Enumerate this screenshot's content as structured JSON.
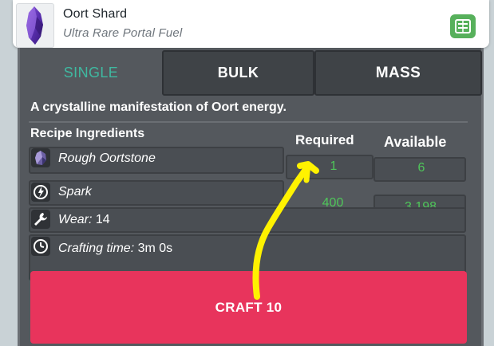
{
  "item": {
    "name": "Oort Shard",
    "subtitle": "Ultra Rare Portal Fuel",
    "thumbnail_icon": "crystal-shard-icon",
    "recipe_icon": "recipe-book-icon"
  },
  "tabs": [
    {
      "label": "SINGLE",
      "selected": true
    },
    {
      "label": "BULK",
      "selected": false
    },
    {
      "label": "MASS",
      "selected": false
    }
  ],
  "description": "A crystalline manifestation of Oort energy.",
  "columns": {
    "ingredients": "Recipe Ingredients",
    "required": "Required",
    "available": "Available"
  },
  "ingredients": [
    {
      "name": "Rough Oortstone",
      "required": "1",
      "available": "6",
      "icon": "oortstone-icon"
    },
    {
      "name": "Spark",
      "required": "400",
      "available": "3,198",
      "icon": "spark-icon"
    }
  ],
  "wear": {
    "label": "Wear:",
    "value": "14",
    "icon": "wrench-icon"
  },
  "crafting_time": {
    "label": "Crafting time:",
    "value": "3m 0s",
    "icon": "clock-icon"
  },
  "craft_button": "CRAFT 10",
  "colors": {
    "accent_teal": "#3fb9a1",
    "value_green": "#4fc65a",
    "craft_red": "#e8345c",
    "annotation_yellow": "#fff200",
    "panel": "#54585d"
  }
}
